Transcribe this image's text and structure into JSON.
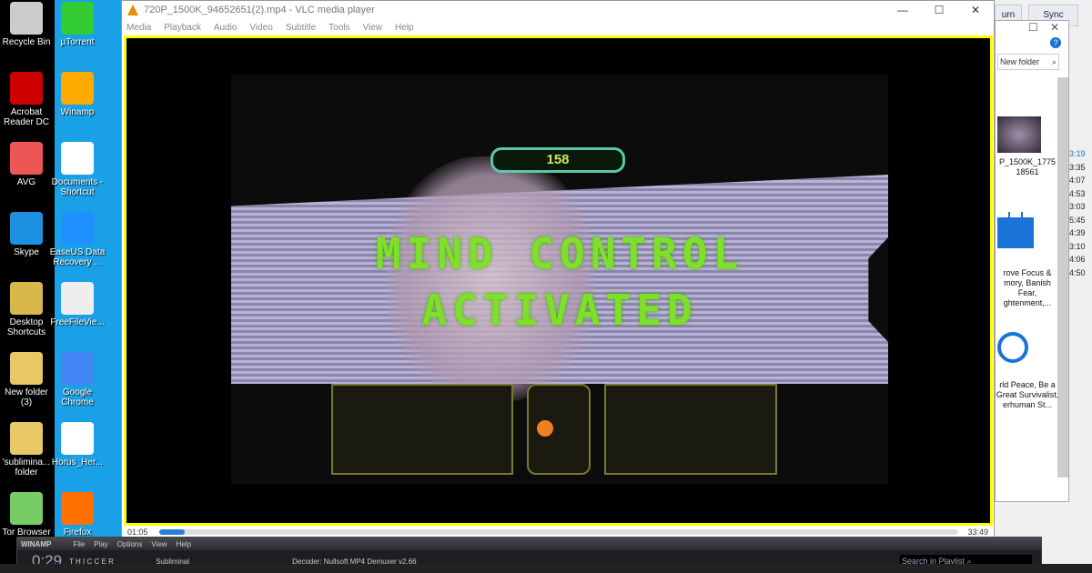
{
  "desktop": {
    "icons_col1": [
      "Recycle Bin",
      "Acrobat Reader DC",
      "AVG",
      "Skype",
      "Desktop Shortcuts",
      "New folder (3)",
      "'sublimina... folder",
      "Tor Browser"
    ],
    "icons_col2": [
      "µTorrent",
      "Winamp",
      "Documents - Shortcut",
      "EaseUS Data Recovery ...",
      "FreeFileVie...",
      "Google Chrome",
      "Horus_Her...",
      "Firefox"
    ]
  },
  "vlc": {
    "title": "720P_1500K_94652651(2).mp4 - VLC media player",
    "menu": [
      "Media",
      "Playback",
      "Audio",
      "Video",
      "Subtitle",
      "Tools",
      "View",
      "Help"
    ],
    "video": {
      "line1": "MIND CONTROL",
      "line2": "ACTIVATED",
      "counter": "158"
    },
    "elapsed": "01:05",
    "total": "33:49",
    "progress_percent": 3.2
  },
  "explorer": {
    "tabs": [
      "urn",
      "Sync"
    ],
    "search_placeholder": "New folder",
    "files": [
      "P_1500K_1775 18561",
      "rove Focus & mory, Banish Fear, ghtenment,...",
      "rld Peace, Be a Great Survivalist, erhuman St..."
    ],
    "durations": [
      "3:19",
      "3:35",
      "4:07",
      "4:53",
      "3:03",
      "5:45",
      "4:39",
      "3:10",
      "4:06",
      "4:50"
    ]
  },
  "winamp": {
    "title": "WINAMP",
    "menu": [
      "File",
      "Play",
      "Options",
      "View",
      "Help"
    ],
    "time": "0:29",
    "track": "T H I C C E R",
    "track2": "Subliminal",
    "decoder": "Decoder: Nullsoft MP4 Demuxer v2.66",
    "playlist_search": "Search in Playlist"
  },
  "colors": {
    "desktop_blue": "#19a0e6",
    "vlc_border": "#ffff00",
    "hud_green": "#7fe02a"
  }
}
